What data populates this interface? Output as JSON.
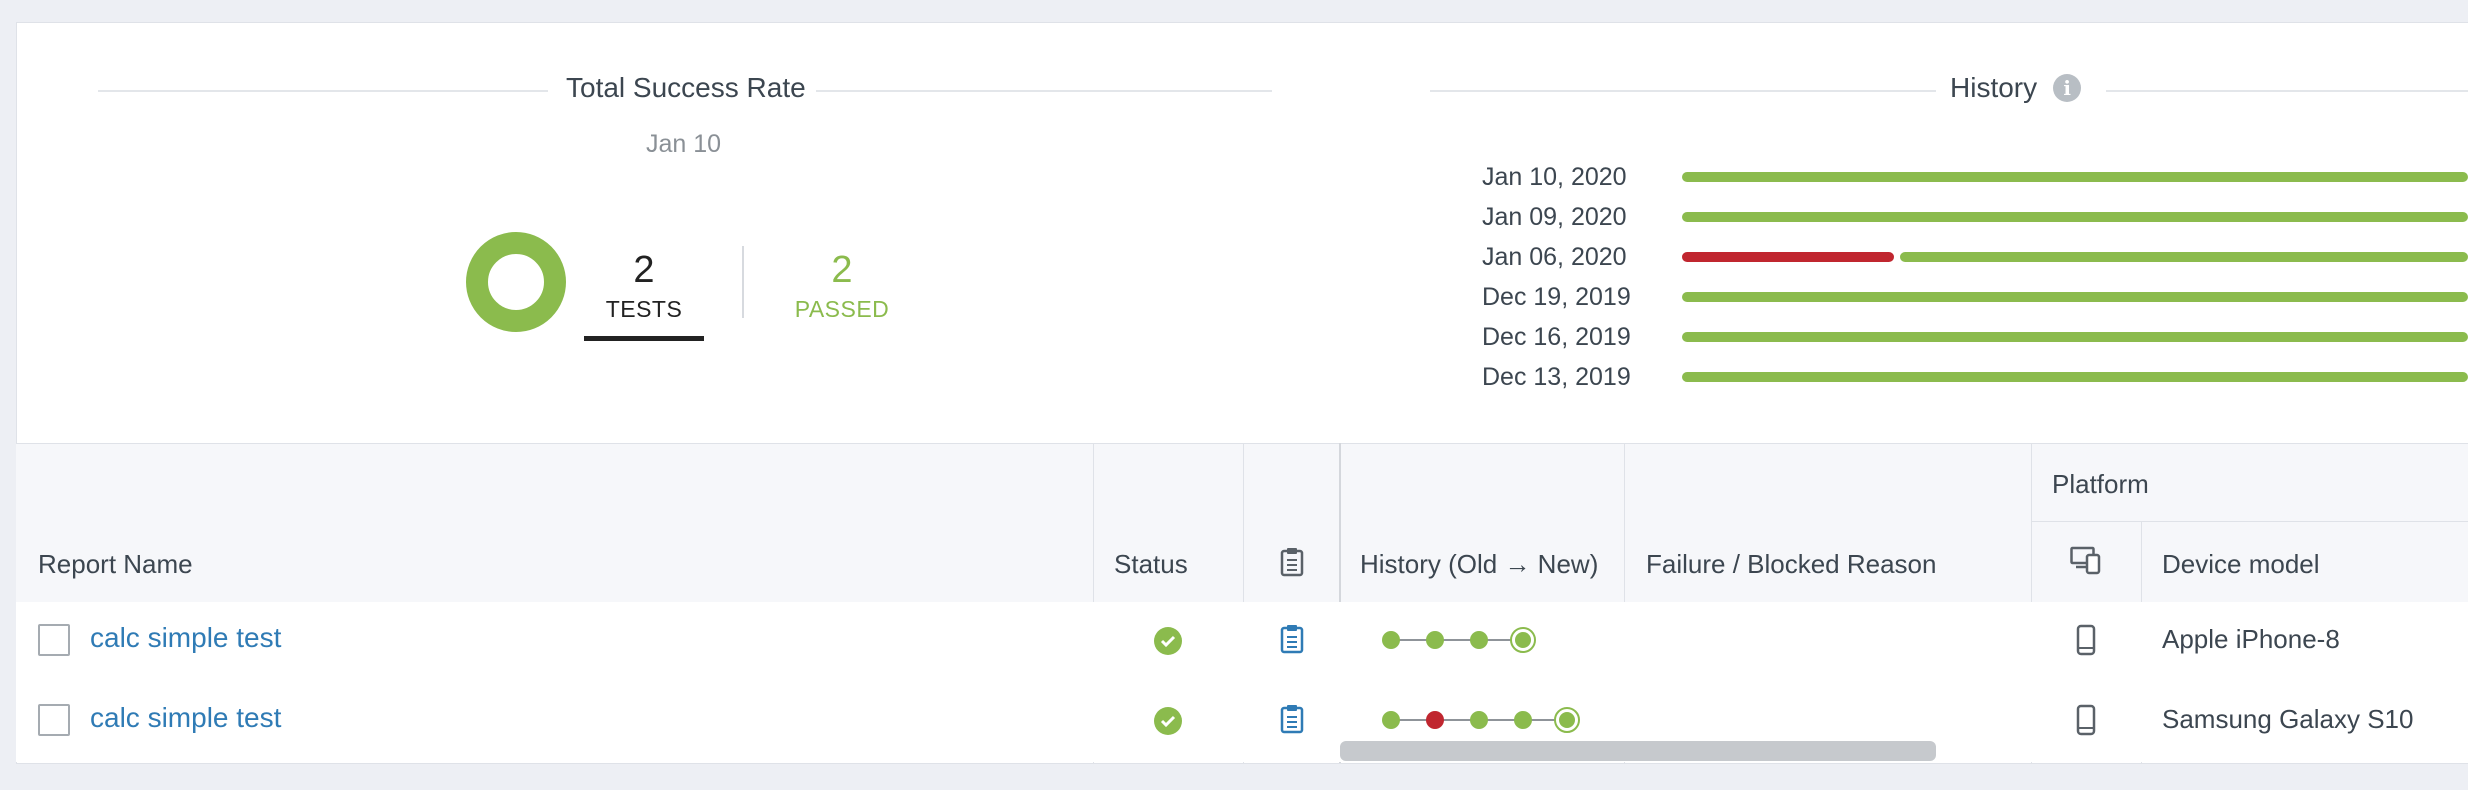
{
  "summary": {
    "title": "Total Success Rate",
    "date": "Jan 10",
    "tests_count": "2",
    "tests_label": "TESTS",
    "passed_count": "2",
    "passed_label": "PASSED"
  },
  "history": {
    "title": "History",
    "info_icon": "info-icon",
    "rows": [
      {
        "date": "Jan 10, 2020",
        "fail_fraction": 0
      },
      {
        "date": "Jan 09, 2020",
        "fail_fraction": 0
      },
      {
        "date": "Jan 06, 2020",
        "fail_fraction": 0.27
      },
      {
        "date": "Dec 19, 2019",
        "fail_fraction": 0
      },
      {
        "date": "Dec 16, 2019",
        "fail_fraction": 0
      },
      {
        "date": "Dec 13, 2019",
        "fail_fraction": 0
      }
    ]
  },
  "table": {
    "group_header": "Platform",
    "columns": {
      "report_name": "Report Name",
      "status": "Status",
      "history": "History (Old → New)",
      "failure_reason": "Failure / Blocked Reason",
      "device_model": "Device model"
    },
    "rows": [
      {
        "name": "calc simple test",
        "status": "passed",
        "history": [
          "passed",
          "passed",
          "passed",
          "passed"
        ],
        "device_model": "Apple iPhone-8",
        "failure_reason": ""
      },
      {
        "name": "calc simple test",
        "status": "passed",
        "history": [
          "passed",
          "failed",
          "passed",
          "passed",
          "passed"
        ],
        "device_model": "Samsung Galaxy S10",
        "failure_reason": ""
      }
    ]
  },
  "colors": {
    "pass": "#8bbb4d",
    "fail": "#c0262f",
    "link": "#2f7bb5"
  }
}
